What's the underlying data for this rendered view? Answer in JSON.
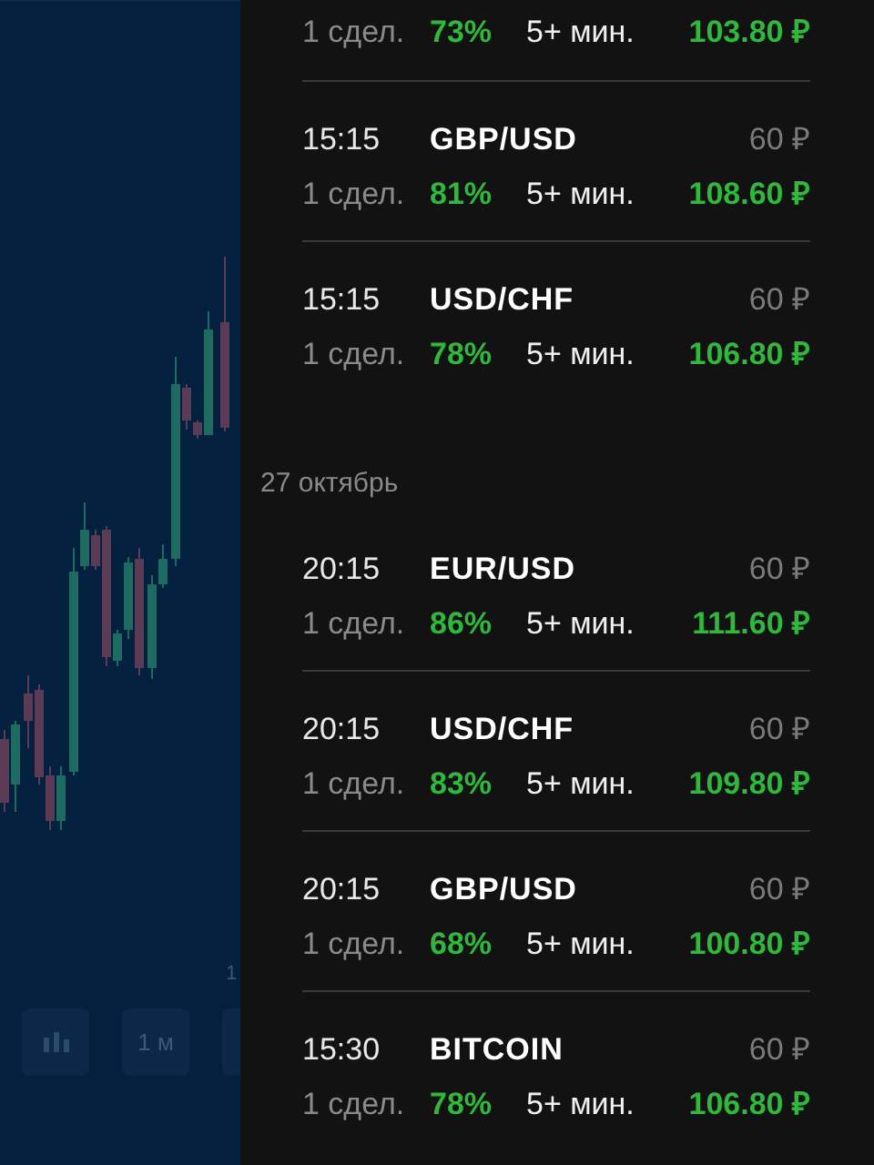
{
  "chart": {
    "time_label": "1",
    "buttons": [
      {
        "kind": "chart-type"
      },
      {
        "kind": "timeframe",
        "label": "1 м"
      },
      {
        "kind": "hidden"
      }
    ]
  },
  "groups": [
    {
      "trades": [
        {
          "deals": "1 сдел.",
          "percent": "73%",
          "duration": "5+ мин.",
          "payout": "103.80 ₽"
        },
        {
          "time": "15:15",
          "pair": "GBP/USD",
          "stake": "60 ₽",
          "deals": "1 сдел.",
          "percent": "81%",
          "duration": "5+ мин.",
          "payout": "108.60 ₽"
        },
        {
          "time": "15:15",
          "pair": "USD/CHF",
          "stake": "60 ₽",
          "deals": "1 сдел.",
          "percent": "78%",
          "duration": "5+ мин.",
          "payout": "106.80 ₽"
        }
      ]
    },
    {
      "date": "27 октябрь",
      "trades": [
        {
          "time": "20:15",
          "pair": "EUR/USD",
          "stake": "60 ₽",
          "deals": "1 сдел.",
          "percent": "86%",
          "duration": "5+ мин.",
          "payout": "111.60 ₽"
        },
        {
          "time": "20:15",
          "pair": "USD/CHF",
          "stake": "60 ₽",
          "deals": "1 сдел.",
          "percent": "83%",
          "duration": "5+ мин.",
          "payout": "109.80 ₽"
        },
        {
          "time": "20:15",
          "pair": "GBP/USD",
          "stake": "60 ₽",
          "deals": "1 сдел.",
          "percent": "68%",
          "duration": "5+ мин.",
          "payout": "100.80 ₽"
        },
        {
          "time": "15:30",
          "pair": "BITCOIN",
          "stake": "60 ₽",
          "deals": "1 сдел.",
          "percent": "78%",
          "duration": "5+ мин.",
          "payout": "106.80 ₽"
        }
      ]
    }
  ]
}
